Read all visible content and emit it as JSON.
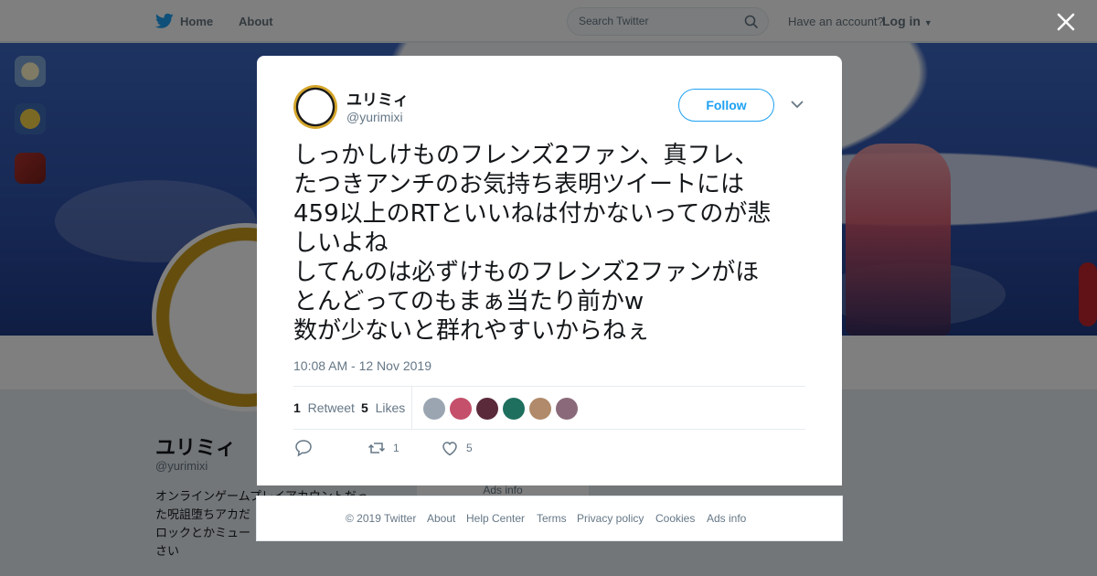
{
  "topbar": {
    "home_label": "Home",
    "about_label": "About",
    "search_placeholder": "Search Twitter",
    "have_account": "Have an account?",
    "login_label": "Log in"
  },
  "profile": {
    "name": "ユリミィ",
    "handle": "@yurimixi",
    "bio_line1": "オンラインゲームプレイアカウントだっ",
    "bio_line2": "た呪詛堕ちアカだ",
    "bio_line3": "ロックとかミュー",
    "bio_line4": "さい",
    "ads_info": "Ads info"
  },
  "tweet": {
    "author_name": "ユリミィ",
    "author_handle": "@yurimixi",
    "follow_label": "Follow",
    "text": "しっかしけものフレンズ2ファン、真フレ、\nたつきアンチのお気持ち表明ツイートには\n459以上のRTといいねは付かないってのが悲\nしいよね\nしてんのは必ずけものフレンズ2ファンがほ\nとんどってのもまぁ当たり前かw\n数が少ないと群れやすいからねぇ",
    "timestamp": "10:08 AM - 12 Nov 2019",
    "retweet_count": "1",
    "retweet_label": "Retweet",
    "like_count": "5",
    "like_label": "Likes",
    "action_retweet_count": "1",
    "action_like_count": "5"
  },
  "likers": [
    {
      "name": "liker-1",
      "color": "#9aa5b1"
    },
    {
      "name": "liker-2",
      "color": "#c4506b"
    },
    {
      "name": "liker-3",
      "color": "#5a2a3a"
    },
    {
      "name": "liker-4",
      "color": "#1f6f5f"
    },
    {
      "name": "liker-5",
      "color": "#b08a6a"
    },
    {
      "name": "liker-6",
      "color": "#8a6a7a"
    }
  ],
  "footer": {
    "copyright": "© 2019 Twitter",
    "about": "About",
    "help": "Help Center",
    "terms": "Terms",
    "privacy": "Privacy policy",
    "cookies": "Cookies",
    "ads": "Ads info"
  },
  "colors": {
    "accent": "#1da1f2",
    "secondary_text": "#657786",
    "primary_text": "#14171a"
  }
}
